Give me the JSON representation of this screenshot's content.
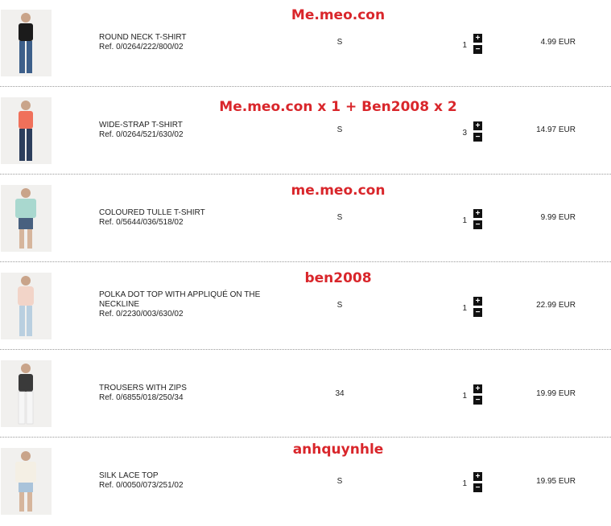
{
  "cart": {
    "items": [
      {
        "annotation": "Me.meo.con",
        "name": "ROUND NECK T-SHIRT",
        "ref": "Ref. 0/0264/222/800/02",
        "size": "S",
        "qty": "1",
        "price": "4.99 EUR",
        "top_color": "#1b1b1b",
        "bottom_color": "#3d5f8a"
      },
      {
        "annotation": "Me.meo.con x 1 + Ben2008 x 2",
        "name": "WIDE-STRAP T-SHIRT",
        "ref": "Ref. 0/0264/521/630/02",
        "size": "S",
        "qty": "3",
        "price": "14.97 EUR",
        "top_color": "#f0705a",
        "bottom_color": "#2c3e5c"
      },
      {
        "annotation": "me.meo.con",
        "name": "COLOURED TULLE T-SHIRT",
        "ref": "Ref. 0/5644/036/518/02",
        "size": "S",
        "qty": "1",
        "price": "9.99 EUR",
        "top_color": "#a9d8cf",
        "bottom_color": "#48607f"
      },
      {
        "annotation": "ben2008",
        "name": "POLKA DOT TOP WITH APPLIQUÉ ON THE NECKLINE",
        "ref": "Ref. 0/2230/003/630/02",
        "size": "S",
        "qty": "1",
        "price": "22.99 EUR",
        "top_color": "#f2d4c8",
        "bottom_color": "#b9cfe0"
      },
      {
        "annotation": "",
        "name": "TROUSERS WITH ZIPS",
        "ref": "Ref. 0/6855/018/250/34",
        "size": "34",
        "qty": "1",
        "price": "19.99 EUR",
        "top_color": "#3a3a3a",
        "bottom_color": "#f6f6f6"
      },
      {
        "annotation": "anhquynhle",
        "name": "SILK LACE TOP",
        "ref": "Ref. 0/0050/073/251/02",
        "size": "S",
        "qty": "1",
        "price": "19.95 EUR",
        "top_color": "#f4efe4",
        "bottom_color": "#a9c3da"
      }
    ],
    "increase_glyph": "+",
    "decrease_glyph": "−",
    "icons": {
      "increase": "plus-icon",
      "decrease": "minus-icon"
    },
    "colors": {
      "annotation": "#d9262b",
      "stepper": "#111111",
      "divider": "#9a9a9a"
    }
  }
}
